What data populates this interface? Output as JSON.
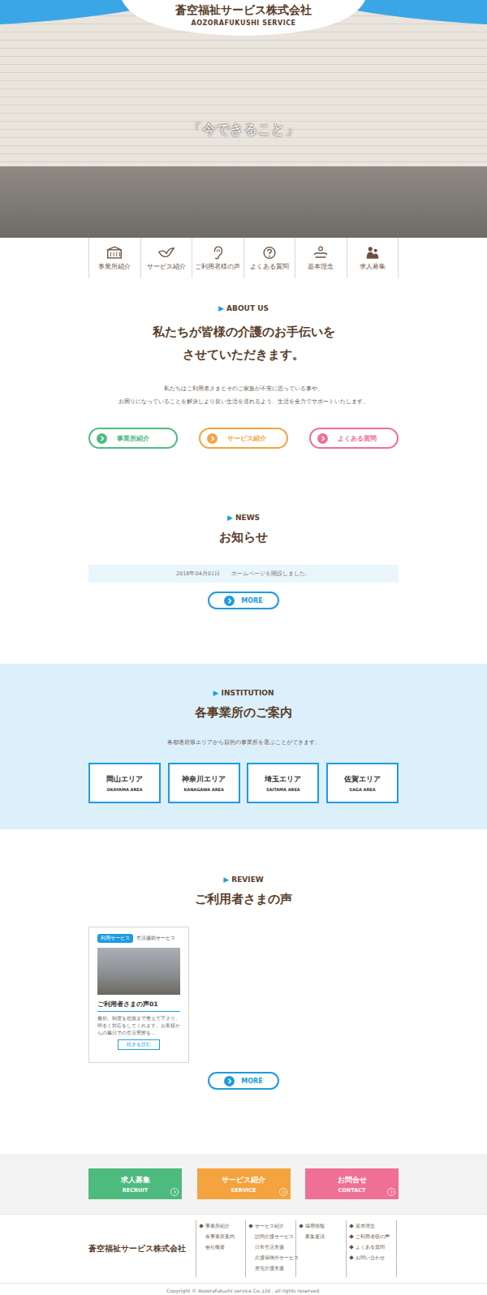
{
  "header": {
    "company": "蒼空福祉サービス株式会社",
    "company_en": "AOZORAFUKUSHI SERVICE",
    "caption": "「今できること」"
  },
  "nav": [
    {
      "label": "事業所紹介"
    },
    {
      "label": "サービス紹介"
    },
    {
      "label": "ご利用者様の声"
    },
    {
      "label": "よくある質問"
    },
    {
      "label": "基本理念"
    },
    {
      "label": "求人募集"
    }
  ],
  "about": {
    "mark": "▶",
    "label": "ABOUT US",
    "heading": [
      "私たちが皆様の介護のお手伝いを",
      "させていただきます。"
    ],
    "text": [
      "私たちはご利用者さまとそのご家族が不安に思っている事や、",
      "お困りになっていることを解決しより良い生活を送れるよう、生活を全力でサポートいたします。"
    ],
    "buttons": [
      {
        "label": "事業所紹介",
        "color": "#4dbb7e"
      },
      {
        "label": "サービス紹介",
        "color": "#f5a33f"
      },
      {
        "label": "よくある質問",
        "color": "#ef6f95"
      }
    ]
  },
  "news": {
    "mark": "▶",
    "label": "NEWS",
    "heading": "お知らせ",
    "items": [
      {
        "date": "2018年04月01日",
        "title": "ホームページを開設しました。"
      }
    ],
    "more": "MORE"
  },
  "institution": {
    "mark": "▶",
    "label": "INSTITUTION",
    "heading": "各事業所のご案内",
    "text": "各都道府県エリアから目的の事業所を選ぶことができます。",
    "areas": [
      {
        "name": "岡山エリア",
        "en": "OKAYAMA AREA"
      },
      {
        "name": "神奈川エリア",
        "en": "KANAGAWA AREA"
      },
      {
        "name": "埼玉エリア",
        "en": "SAITAMA AREA"
      },
      {
        "name": "佐賀エリア",
        "en": "SAGA AREA"
      }
    ]
  },
  "review": {
    "mark": "▶",
    "label": "REVIEW",
    "heading": "ご利用者さまの声",
    "cards": [
      {
        "badge": "利用サービス",
        "service": "生活援助サービス",
        "title": "ご利用者さまの声01",
        "text": "最初、制度を把握まで整えて下さり、明るく対応をしてくれます。お客様からの毎日での生活実態を…",
        "button": "続きを読む"
      }
    ],
    "more": "MORE"
  },
  "cta": [
    {
      "label": "求人募集",
      "en": "RECRUIT",
      "color": "#4dbb7e"
    },
    {
      "label": "サービス紹介",
      "en": "SERVICE",
      "color": "#f5a33f"
    },
    {
      "label": "お問合せ",
      "en": "CONTACT",
      "color": "#ef6f95"
    }
  ],
  "footer": {
    "company": "蒼空福祉サービス株式会社",
    "columns": [
      [
        {
          "label": "事業所紹介",
          "marked": true
        },
        {
          "label": "各事業所案内",
          "marked": false
        },
        {
          "label": "会社概要",
          "marked": false
        }
      ],
      [
        {
          "label": "サービス紹介",
          "marked": true
        },
        {
          "label": "訪問介護サービス",
          "marked": false
        },
        {
          "label": "日常生活支援",
          "marked": false
        },
        {
          "label": "介護保険外サービス",
          "marked": false
        },
        {
          "label": "居宅介護支援",
          "marked": false
        }
      ],
      [
        {
          "label": "採用情報",
          "marked": true
        },
        {
          "label": "募集要項",
          "marked": false
        }
      ],
      [
        {
          "label": "基本理念",
          "marked": true
        },
        {
          "label": "ご利用者様の声",
          "marked": true
        },
        {
          "label": "よくある質問",
          "marked": true
        },
        {
          "label": "お問い合わせ",
          "marked": true
        }
      ]
    ],
    "copyright": "Copyright © Aozorafukushi service Co.,Ltd . all rights reserved."
  }
}
